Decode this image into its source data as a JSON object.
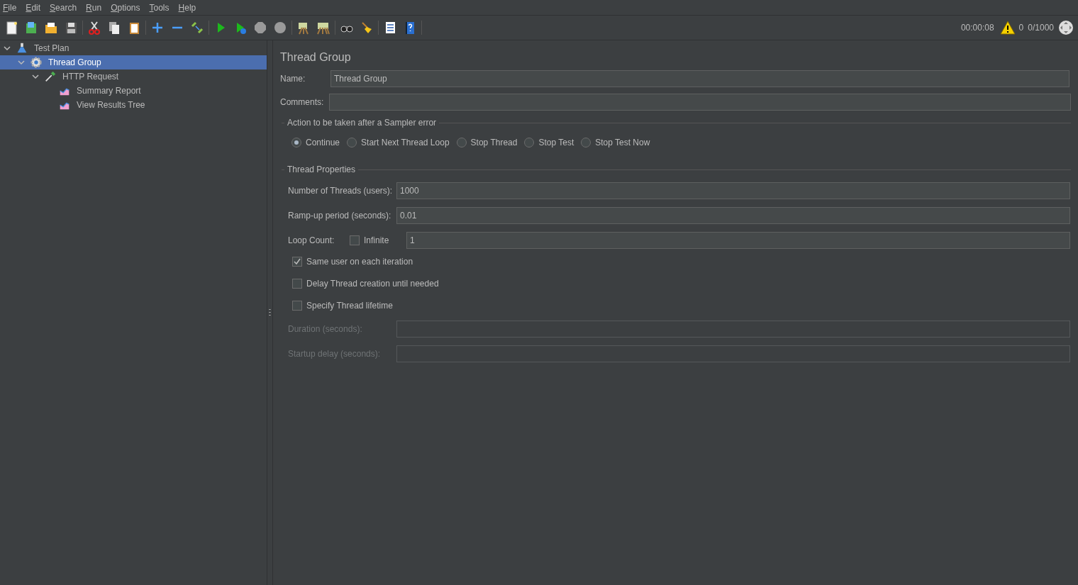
{
  "menu": [
    "File",
    "Edit",
    "Search",
    "Run",
    "Options",
    "Tools",
    "Help"
  ],
  "status": {
    "elapsed": "00:00:08",
    "warnings": "0",
    "threads": "0/1000"
  },
  "tree": [
    {
      "label": "Test Plan",
      "kind": "plan",
      "expanded": true,
      "selected": false,
      "children": [
        {
          "label": "Thread Group",
          "kind": "thread-group",
          "expanded": true,
          "selected": true,
          "children": [
            {
              "label": "HTTP Request",
              "kind": "sampler",
              "expanded": true,
              "selected": false,
              "children": [
                {
                  "label": "Summary Report",
                  "kind": "listener",
                  "selected": false
                },
                {
                  "label": "View Results Tree",
                  "kind": "listener",
                  "selected": false
                }
              ]
            }
          ]
        }
      ]
    }
  ],
  "panel": {
    "title": "Thread Group",
    "name": {
      "label": "Name:",
      "value": "Thread Group"
    },
    "comments": {
      "label": "Comments:"
    },
    "error_action": {
      "legend": "Action to be taken after a Sampler error",
      "options": [
        {
          "label": "Continue",
          "selected": true
        },
        {
          "label": "Start Next Thread Loop",
          "selected": false
        },
        {
          "label": "Stop Thread",
          "selected": false
        },
        {
          "label": "Stop Test",
          "selected": false
        },
        {
          "label": "Stop Test Now",
          "selected": false
        }
      ]
    },
    "thread_properties": {
      "legend": "Thread Properties",
      "threads": {
        "label": "Number of Threads (users):",
        "value": "1000"
      },
      "ramp_up": {
        "label": "Ramp-up period (seconds):",
        "value": "0.01"
      },
      "loop_count": {
        "label": "Loop Count:",
        "infinite": {
          "label": "Infinite",
          "checked": false
        },
        "value": "1"
      },
      "options": [
        {
          "label": "Same user on each iteration",
          "checked": true
        },
        {
          "label": "Delay Thread creation until needed",
          "checked": false
        },
        {
          "label": "Specify Thread lifetime",
          "checked": false
        }
      ],
      "lifetime": [
        {
          "label": "Duration (seconds):",
          "disabled": true
        },
        {
          "label": "Startup delay (seconds):",
          "disabled": true
        }
      ]
    }
  }
}
